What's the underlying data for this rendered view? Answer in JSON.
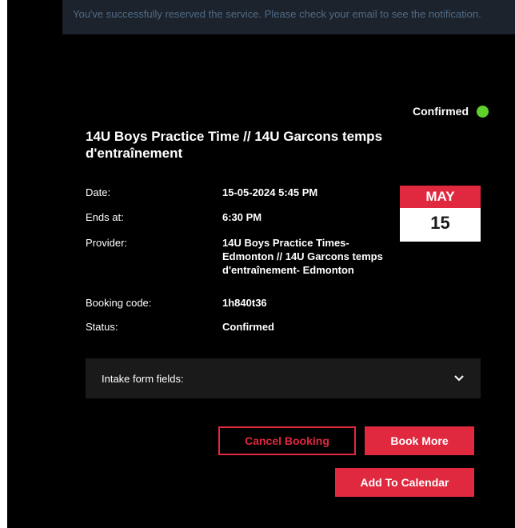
{
  "notification": "You've successfully reserved the service. Please check your email to see the notification.",
  "status_badge": {
    "label": "Confirmed",
    "color": "#5ed22a"
  },
  "title": "14U Boys Practice Time // 14U Garcons temps d'entraînement",
  "details": {
    "date": {
      "label": "Date:",
      "value": "15-05-2024 5:45 PM"
    },
    "ends_at": {
      "label": "Ends at:",
      "value": "6:30 PM"
    },
    "provider": {
      "label": "Provider:",
      "value": "14U Boys Practice Times- Edmonton // 14U Garcons temps d'entraînement- Edmonton"
    },
    "booking_code": {
      "label": "Booking code:",
      "value": "1h840t36"
    },
    "status": {
      "label": "Status:",
      "value": "Confirmed"
    }
  },
  "calendar": {
    "month": "MAY",
    "day": "15"
  },
  "intake": {
    "label": "Intake form fields:",
    "icon": "chevron-down-icon"
  },
  "buttons": {
    "cancel": "Cancel Booking",
    "book_more": "Book More",
    "add_calendar": "Add To Calendar"
  },
  "colors": {
    "accent": "#e0283f",
    "background": "#000000"
  }
}
